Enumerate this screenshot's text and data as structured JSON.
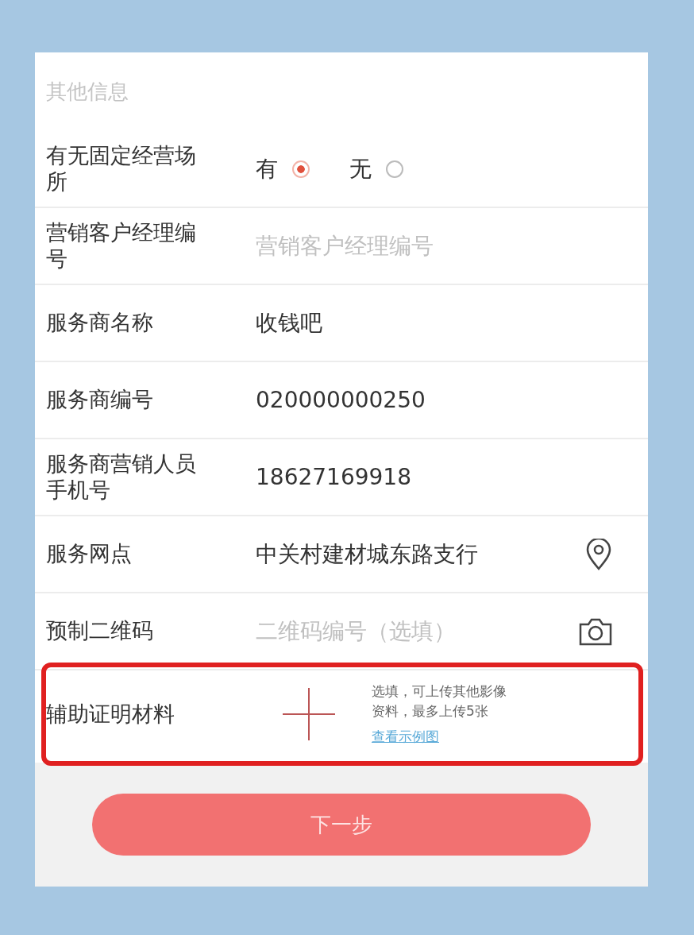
{
  "section_title": "其他信息",
  "rows": [
    {
      "kind": "radio",
      "label": "有无固定经营场所",
      "options": [
        {
          "label": "有",
          "selected": true
        },
        {
          "label": "无",
          "selected": false
        }
      ]
    },
    {
      "kind": "input",
      "label": "营销客户经理编号",
      "placeholder": "营销客户经理编号"
    },
    {
      "kind": "text",
      "label": "服务商名称",
      "value": "收钱吧"
    },
    {
      "kind": "text",
      "label": "服务商编号",
      "value": "020000000250"
    },
    {
      "kind": "text",
      "label": "服务商营销人员手机号",
      "value": "18627169918"
    },
    {
      "kind": "location",
      "label": "服务网点",
      "value": "中关村建材城东路支行"
    },
    {
      "kind": "scan",
      "label": "预制二维码",
      "placeholder": "二维码编号（选填）"
    }
  ],
  "upload": {
    "label": "辅助证明材料",
    "hint_lines": [
      "选填，可上传其他影像",
      "资料，最多上传5张"
    ],
    "link": "查看示例图",
    "highlighted": true
  },
  "next_button": "下一步"
}
